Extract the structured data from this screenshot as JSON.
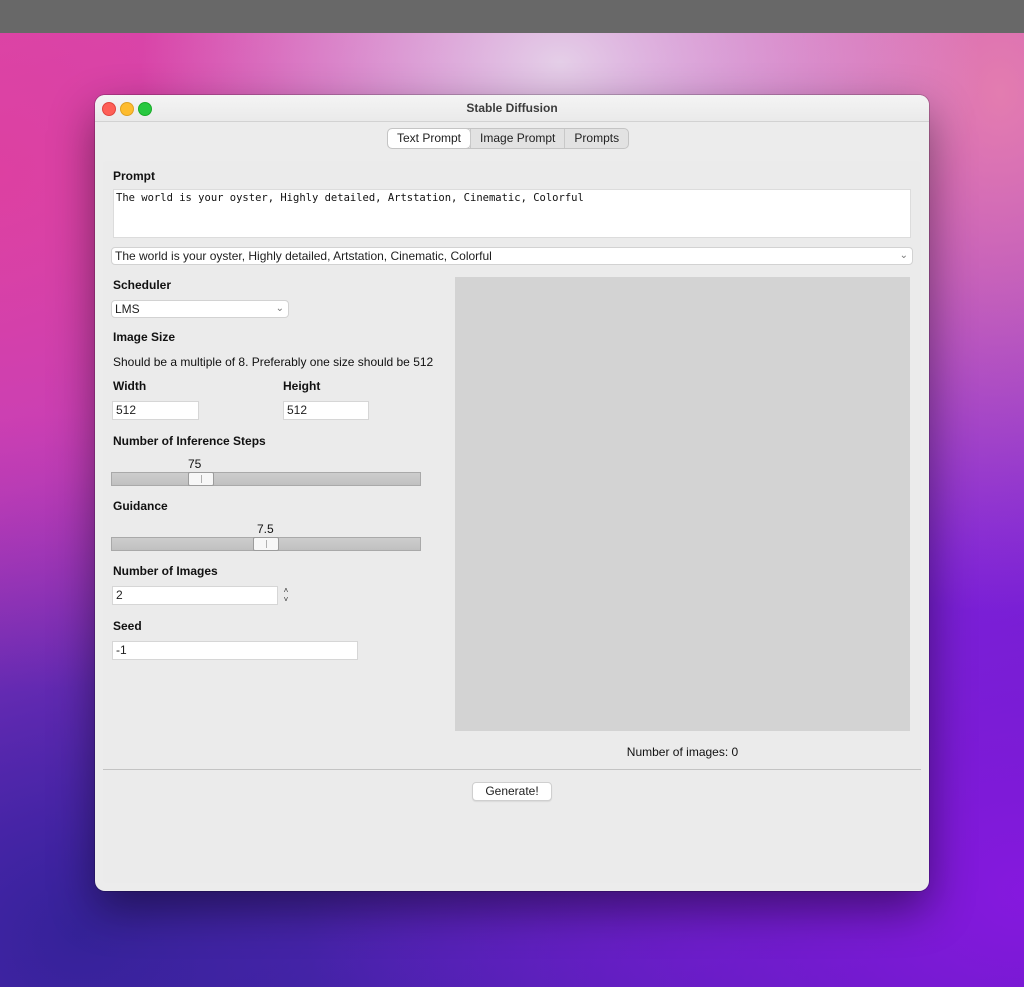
{
  "window": {
    "title": "Stable Diffusion"
  },
  "tabs": [
    {
      "label": "Text Prompt",
      "active": true
    },
    {
      "label": "Image Prompt",
      "active": false
    },
    {
      "label": "Prompts",
      "active": false
    }
  ],
  "prompt": {
    "label": "Prompt",
    "value": "The world is your oyster, Highly detailed, Artstation, Cinematic, Colorful",
    "history_selected": "The world is your oyster, Highly detailed, Artstation, Cinematic, Colorful"
  },
  "scheduler": {
    "label": "Scheduler",
    "selected": "LMS"
  },
  "image_size": {
    "label": "Image Size",
    "hint": "Should be a multiple of 8. Preferably one size should be 512",
    "width_label": "Width",
    "width_value": "512",
    "height_label": "Height",
    "height_value": "512"
  },
  "inference_steps": {
    "label": "Number of Inference Steps",
    "value": "75",
    "fraction": 0.27
  },
  "guidance": {
    "label": "Guidance",
    "value": "7.5",
    "fraction": 0.5
  },
  "num_images": {
    "label": "Number of Images",
    "value": "2"
  },
  "seed": {
    "label": "Seed",
    "value": "-1"
  },
  "preview": {
    "status": "Number of images: 0"
  },
  "actions": {
    "generate_label": "Generate!"
  },
  "colors": {
    "close": "#fe5f57",
    "minimize": "#febc2e",
    "maximize": "#28c840",
    "preview_bg": "#d3d3d3"
  }
}
